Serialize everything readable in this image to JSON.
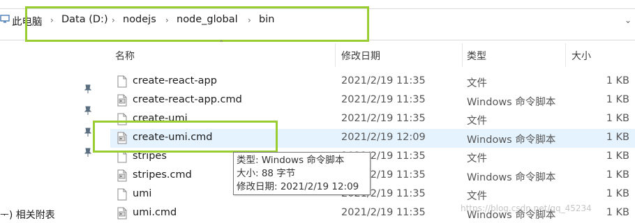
{
  "address_bar": {
    "crumbs": [
      "此电脑",
      "Data (D:)",
      "nodejs",
      "node_global",
      "bin"
    ],
    "separator": "›",
    "dropdown": "⌄"
  },
  "columns": {
    "name": "名称",
    "date": "修改日期",
    "type": "类型",
    "size": "大小"
  },
  "files": [
    {
      "name": "create-react-app",
      "date": "2021/2/19 11:35",
      "type": "文件",
      "size": "1 KB",
      "icon": "file-icon"
    },
    {
      "name": "create-react-app.cmd",
      "date": "2021/2/19 11:35",
      "type": "Windows 命令脚本",
      "size": "1 KB",
      "icon": "cmd-file-icon"
    },
    {
      "name": "create-umi",
      "date": "2021/2/19 11:35",
      "type": "文件",
      "size": "1 KB",
      "icon": "file-icon"
    },
    {
      "name": "create-umi.cmd",
      "date": "2021/2/19 12:09",
      "type": "Windows 命令脚本",
      "size": "1 KB",
      "icon": "cmd-file-icon",
      "selected": true
    },
    {
      "name": "stripes",
      "date": "2021/2/19 11:35",
      "type": "文件",
      "size": "1 KB",
      "icon": "file-icon"
    },
    {
      "name": "stripes.cmd",
      "date": "2021/2/19 11:35",
      "type": "Windows 命令脚本",
      "size": "1 KB",
      "icon": "cmd-file-icon"
    },
    {
      "name": "umi",
      "date": "2021/2/19 11:35",
      "type": "文件",
      "size": "1 KB",
      "icon": "file-icon"
    },
    {
      "name": "umi.cmd",
      "date": "2021/2/19 11:35",
      "type": "Windows 命令脚本",
      "size": "1 KB",
      "icon": "cmd-file-icon"
    }
  ],
  "tooltip": {
    "type_line": "类型: Windows 命令脚本",
    "size_line": "大小: 88 字节",
    "date_line": "修改日期: 2021/2/19 12:09"
  },
  "nav": {
    "partial_item": "ᅮ) 相关附表"
  },
  "watermark": "https://blog.csdn.net/qq_45234"
}
